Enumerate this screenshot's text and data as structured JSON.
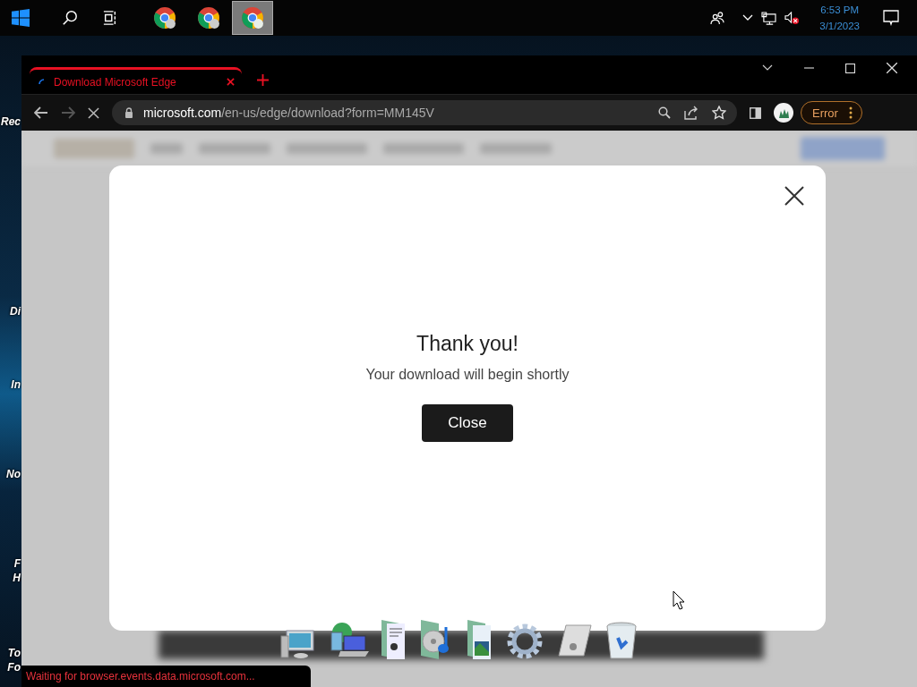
{
  "taskbar": {
    "apps": [
      {
        "selected": false
      },
      {
        "selected": false
      },
      {
        "selected": true
      }
    ],
    "clock_time": "6:53 PM",
    "clock_date": "3/1/2023"
  },
  "desktop_icons": [
    {
      "lines": [
        "Rec"
      ]
    },
    {
      "lines": [
        "Di"
      ]
    },
    {
      "lines": [
        "In"
      ]
    },
    {
      "lines": [
        "No"
      ]
    },
    {
      "lines": [
        "F",
        "H"
      ]
    },
    {
      "lines": [
        "To",
        "Fo"
      ]
    }
  ],
  "browser": {
    "tab": {
      "title": "Download Microsoft Edge",
      "loading": true
    },
    "url_host": "microsoft.com",
    "url_path": "/en-us/edge/download?form=MM145V",
    "profile_status": "Error"
  },
  "modal": {
    "title": "Thank you!",
    "message": "Your download will begin shortly",
    "button": "Close"
  },
  "status_bar": "Waiting for browser.events.data.microsoft.com..."
}
